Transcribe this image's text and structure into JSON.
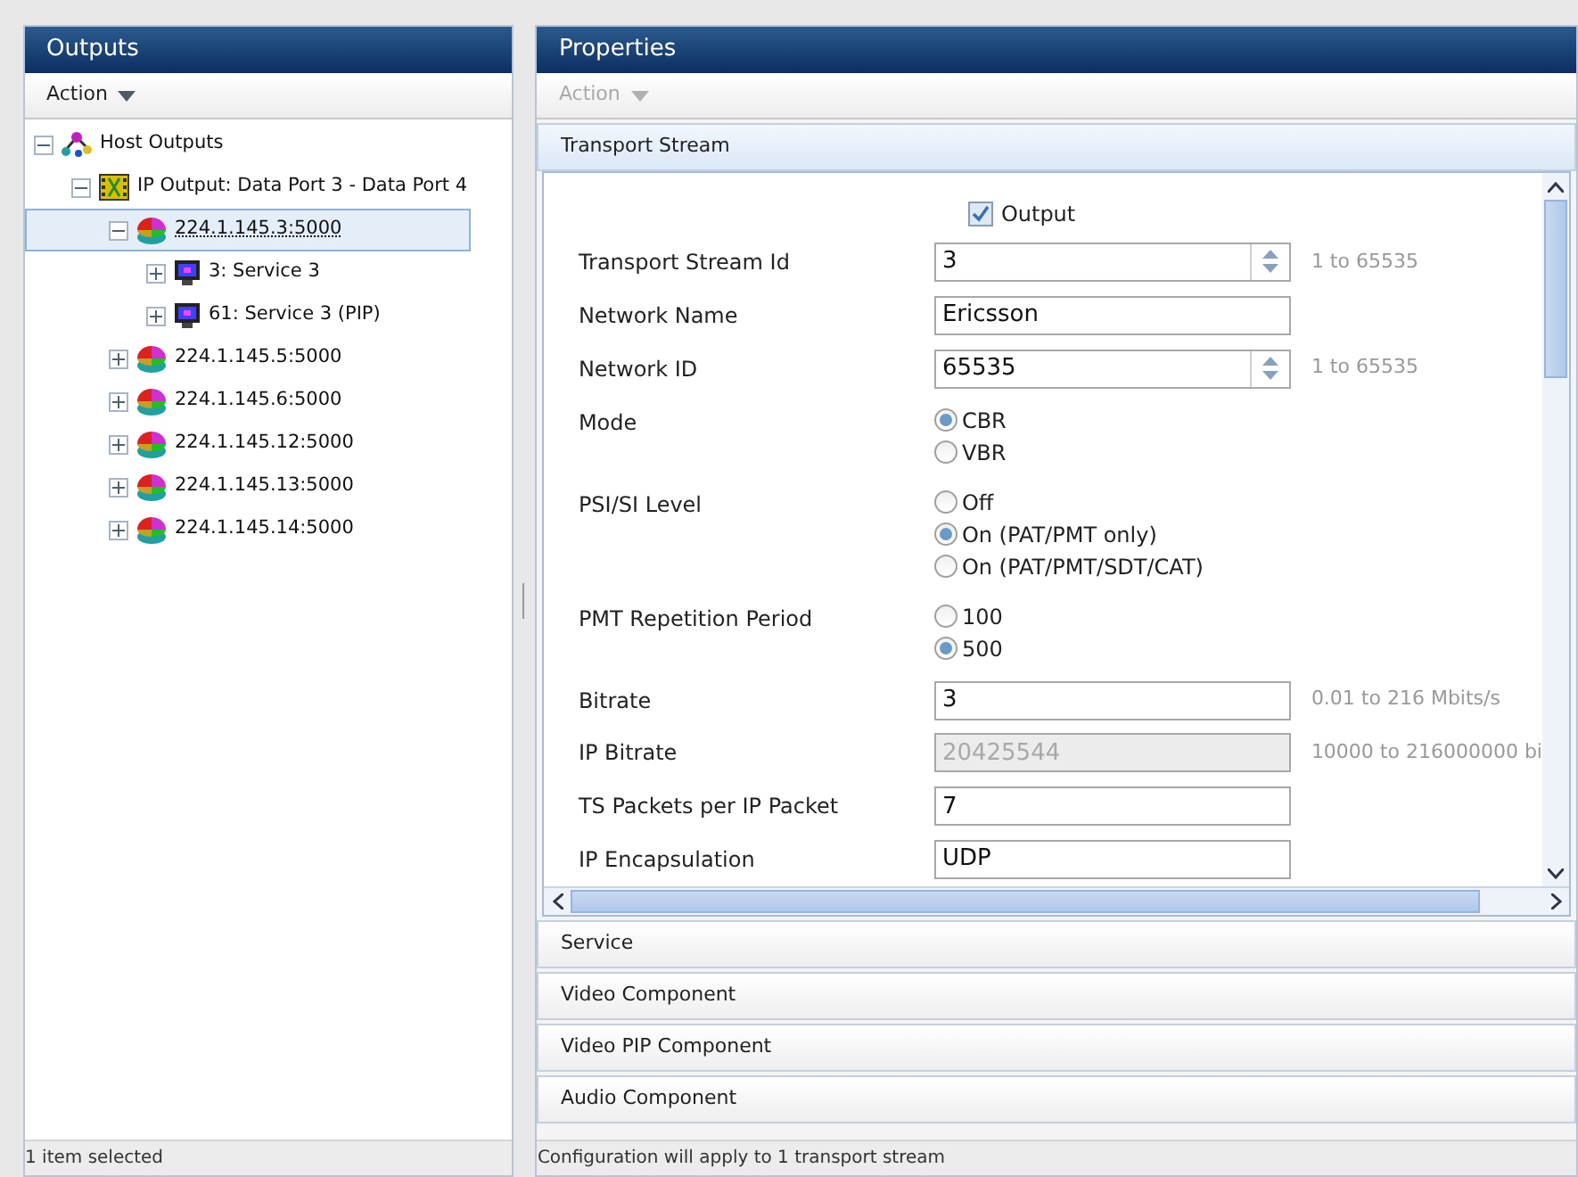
{
  "outputs_panel": {
    "title": "Outputs",
    "action": {
      "label": "Action",
      "disabled": false
    },
    "tree": [
      {
        "kind": "host",
        "label": "Host Outputs",
        "expanded": true,
        "selected": false,
        "children": [
          {
            "kind": "ip-output",
            "label": "IP Output: Data Port 3 - Data Port 4",
            "expanded": true,
            "selected": false,
            "children": [
              {
                "kind": "stream",
                "label": "224.1.145.3:5000",
                "expanded": true,
                "selected": true,
                "children": [
                  {
                    "kind": "service",
                    "label": "3: Service 3",
                    "expanded": false,
                    "selected": false
                  },
                  {
                    "kind": "service",
                    "label": "61: Service 3 (PIP)",
                    "expanded": false,
                    "selected": false
                  }
                ]
              },
              {
                "kind": "stream",
                "label": "224.1.145.5:5000",
                "expanded": false,
                "selected": false
              },
              {
                "kind": "stream",
                "label": "224.1.145.6:5000",
                "expanded": false,
                "selected": false
              },
              {
                "kind": "stream",
                "label": "224.1.145.12:5000",
                "expanded": false,
                "selected": false
              },
              {
                "kind": "stream",
                "label": "224.1.145.13:5000",
                "expanded": false,
                "selected": false
              },
              {
                "kind": "stream",
                "label": "224.1.145.14:5000",
                "expanded": false,
                "selected": false
              }
            ]
          }
        ]
      }
    ],
    "status_bar": "1 item selected"
  },
  "properties_panel": {
    "title": "Properties",
    "action": {
      "label": "Action",
      "disabled": true
    },
    "sections": [
      {
        "title": "Transport Stream",
        "expanded": true
      },
      {
        "title": "Service",
        "expanded": false
      },
      {
        "title": "Video Component",
        "expanded": false
      },
      {
        "title": "Video PIP Component",
        "expanded": false
      },
      {
        "title": "Audio Component",
        "expanded": false
      }
    ],
    "fields": [
      {
        "kind": "checkbox",
        "label": "Output",
        "checked": true
      },
      {
        "kind": "spin",
        "label": "Transport Stream Id",
        "value": "3",
        "hint": "1 to 65535"
      },
      {
        "kind": "text",
        "label": "Network Name",
        "value": "Ericsson",
        "disabled": false
      },
      {
        "kind": "spin",
        "label": "Network ID",
        "value": "65535",
        "hint": "1 to 65535"
      },
      {
        "kind": "radio",
        "label": "Mode",
        "options": [
          {
            "label": "CBR",
            "selected": true
          },
          {
            "label": "VBR",
            "selected": false
          }
        ]
      },
      {
        "kind": "radio",
        "label": "PSI/SI Level",
        "options": [
          {
            "label": "Off",
            "selected": false
          },
          {
            "label": "On (PAT/PMT only)",
            "selected": true
          },
          {
            "label": "On (PAT/PMT/SDT/CAT)",
            "selected": false
          }
        ]
      },
      {
        "kind": "radio",
        "label": "PMT Repetition Period",
        "options": [
          {
            "label": "100",
            "selected": false
          },
          {
            "label": "500",
            "selected": true
          }
        ]
      },
      {
        "kind": "text",
        "label": "Bitrate",
        "value": "3",
        "hint": "0.01 to 216 Mbits/s",
        "disabled": false
      },
      {
        "kind": "text",
        "label": "IP Bitrate",
        "value": "20425544",
        "hint": "10000 to 216000000 bi",
        "disabled": true
      },
      {
        "kind": "text",
        "label": "TS Packets per IP Packet",
        "value": "7",
        "disabled": false
      },
      {
        "kind": "text",
        "label": "IP Encapsulation",
        "value": "UDP",
        "disabled": false
      }
    ],
    "status_bar": "Configuration will apply to 1 transport stream"
  }
}
